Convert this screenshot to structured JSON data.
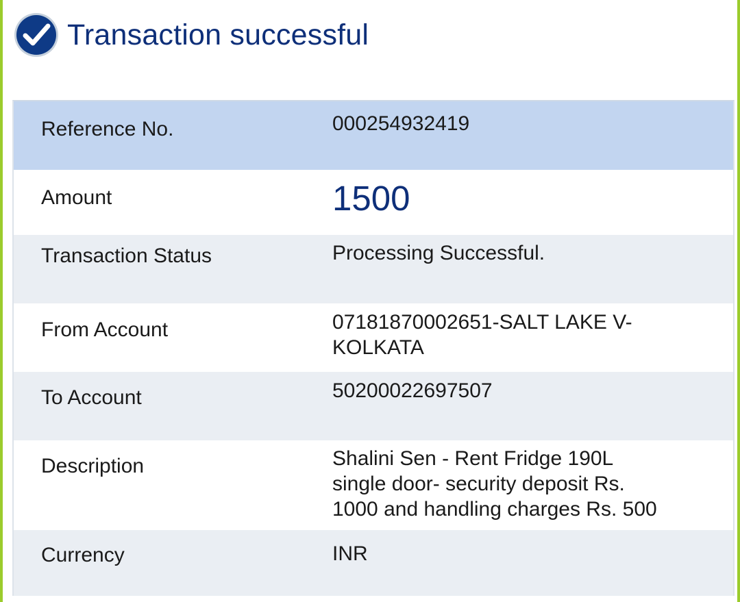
{
  "header": {
    "icon": "check-circle-icon",
    "title": "Transaction successful"
  },
  "colors": {
    "accent": "#0e2f79",
    "border_green": "#9bcc2c",
    "highlight_row": "#c2d5f0",
    "alt_row": "#eaeef3"
  },
  "details": {
    "reference": {
      "label": "Reference No.",
      "value": "000254932419"
    },
    "amount": {
      "label": "Amount",
      "value": "1500"
    },
    "status": {
      "label": "Transaction Status",
      "value": "Processing Successful."
    },
    "from_account": {
      "label": "From Account",
      "value_lines": [
        "07181870002651-SALT LAKE V-",
        "KOLKATA"
      ]
    },
    "to_account": {
      "label": "To Account",
      "value": "50200022697507"
    },
    "description": {
      "label": "Description",
      "value_lines": [
        "Shalini Sen - Rent Fridge 190L",
        "single door- security deposit Rs.",
        "1000 and handling charges Rs. 500"
      ]
    },
    "currency": {
      "label": "Currency",
      "value": "INR"
    }
  }
}
